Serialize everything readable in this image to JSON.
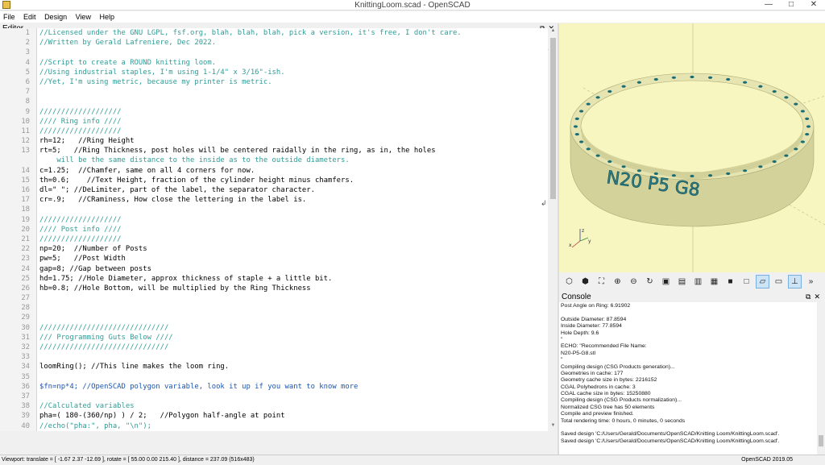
{
  "window": {
    "title": "KnittingLoom.scad - OpenSCAD"
  },
  "menu": [
    "File",
    "Edit",
    "Design",
    "View",
    "Help"
  ],
  "editor": {
    "title": "Editor",
    "lines": [
      {
        "n": "1",
        "t": "//Licensed under the GNU LGPL, fsf.org, blah, blah, blah, pick a version, it's free, I don't care."
      },
      {
        "n": "2",
        "t": "//Written by Gerald Lafreniere, Dec 2022."
      },
      {
        "n": "3",
        "t": ""
      },
      {
        "n": "4",
        "t": "//Script to create a ROUND knitting loom."
      },
      {
        "n": "5",
        "t": "//Using industrial staples, I'm using 1-1/4\" x 3/16\"-ish."
      },
      {
        "n": "6",
        "t": "//Yet, I'm using metric, because my printer is metric."
      },
      {
        "n": "7",
        "t": ""
      },
      {
        "n": "8",
        "t": ""
      },
      {
        "n": "9",
        "t": "///////////////////"
      },
      {
        "n": "10",
        "t": "//// Ring info ////"
      },
      {
        "n": "11",
        "t": "///////////////////"
      },
      {
        "n": "12",
        "t": "rh=12;   //Ring Height"
      },
      {
        "n": "13",
        "t": "rt=5;   //Ring Thickness, post holes will be centered raidally in the ring, as in, the holes"
      },
      {
        "n": "",
        "t": "    will be the same distance to the inside as to the outside diameters."
      },
      {
        "n": "14",
        "t": "c=1.25;  //Chamfer, same on all 4 corners for now."
      },
      {
        "n": "15",
        "t": "th=0.6;    //Text Height, fraction of the cylinder height minus chamfers."
      },
      {
        "n": "16",
        "t": "dl=\" \"; //DeLimiter, part of the label, the separator character."
      },
      {
        "n": "17",
        "t": "cr=.9;   //CRaminess, How close the lettering in the label is."
      },
      {
        "n": "18",
        "t": ""
      },
      {
        "n": "19",
        "t": "///////////////////"
      },
      {
        "n": "20",
        "t": "//// Post info ////"
      },
      {
        "n": "21",
        "t": "///////////////////"
      },
      {
        "n": "22",
        "t": "np=20;  //Number of Posts"
      },
      {
        "n": "23",
        "t": "pw=5;   //Post Width"
      },
      {
        "n": "24",
        "t": "gap=8; //Gap between posts"
      },
      {
        "n": "25",
        "t": "hd=1.75; //Hole Diameter, approx thickness of staple + a little bit."
      },
      {
        "n": "26",
        "t": "hb=0.8; //Hole Bottom, will be multiplied by the Ring Thickness"
      },
      {
        "n": "27",
        "t": ""
      },
      {
        "n": "28",
        "t": ""
      },
      {
        "n": "29",
        "t": ""
      },
      {
        "n": "30",
        "t": "//////////////////////////////"
      },
      {
        "n": "31",
        "t": "/// Programming Guts Below ////"
      },
      {
        "n": "32",
        "t": "//////////////////////////////"
      },
      {
        "n": "33",
        "t": ""
      },
      {
        "n": "34",
        "t": "loomRing(); //This line makes the loom ring."
      },
      {
        "n": "35",
        "t": ""
      },
      {
        "n": "36",
        "t": "$fn=np*4; //OpenSCAD polygon variable, look it up if you want to know more"
      },
      {
        "n": "37",
        "t": ""
      },
      {
        "n": "38",
        "t": "//Calculated variables"
      },
      {
        "n": "39",
        "t": "pha=( 180-(360/np) ) / 2;   //Polygon half-angle at point"
      },
      {
        "n": "40",
        "t": "//echo(\"pha:\", pha, \"\\n\");"
      }
    ]
  },
  "viewport": {
    "label_text": "N20  P5  G8",
    "axis": {
      "x": "x",
      "y": "y",
      "z": "z"
    }
  },
  "console": {
    "title": "Console",
    "lines": [
      "Post Angle on Ring: 6.91902",
      "",
      "Outside Diameter: 87.8594",
      "Inside Diameter: 77.8594",
      "Hole Depth: 9.6",
      "\"",
      "ECHO: \"Recommended File Name:",
      "N20-P5-G8.stl",
      "\"",
      "Compiling design (CSG Products generation)...",
      "Geometries in cache: 177",
      "Geometry cache size in bytes: 2216152",
      "CGAL Polyhedrons in cache: 3",
      "CGAL cache size in bytes: 15250880",
      "Compiling design (CSG Products normalization)...",
      "Normalized CSG tree has 50 elements",
      "Compile and preview finished.",
      "Total rendering time: 0 hours, 0 minutes, 0 seconds",
      "",
      "Saved design 'C:/Users/Gerald/Documents/OpenSCAD/Knitting Loom/KnittingLoom.scad'.",
      "Saved design 'C:/Users/Gerald/Documents/OpenSCAD/Knitting Loom/KnittingLoom.scad'."
    ]
  },
  "status": {
    "viewport": "Viewport: translate = [ -1.67 2.37 -12.69 ], rotate = [ 55.00 0.00 215.40 ], distance = 237.09 (516x483)",
    "version": "OpenSCAD 2019.05"
  },
  "colors": {
    "comment": "#2f9c97",
    "viewport_bg": "#f7f6c0",
    "ring": "#e0dfa8",
    "holes": "#1a6d73"
  }
}
